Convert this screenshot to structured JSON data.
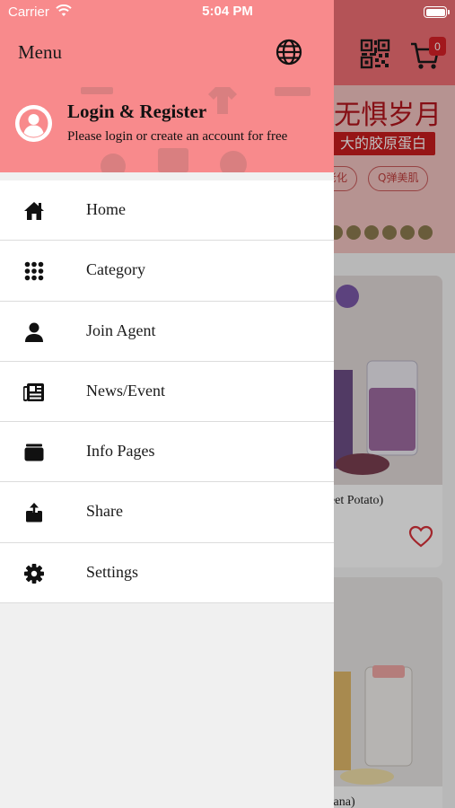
{
  "status_bar": {
    "carrier": "Carrier",
    "time": "5:04 PM"
  },
  "drawer": {
    "title": "Menu",
    "language_icon": "globe-icon",
    "profile": {
      "title": "Login & Register",
      "subtitle": "Please login or create an account for free",
      "avatar_icon": "person-circle-icon"
    },
    "items": [
      {
        "label": "Home",
        "icon": "home-icon"
      },
      {
        "label": "Category",
        "icon": "grid-dots-icon"
      },
      {
        "label": "Join Agent",
        "icon": "person-icon"
      },
      {
        "label": "News/Event",
        "icon": "newspaper-icon"
      },
      {
        "label": "Info Pages",
        "icon": "folder-icon"
      },
      {
        "label": "Share",
        "icon": "share-icon"
      },
      {
        "label": "Settings",
        "icon": "gear-icon"
      }
    ]
  },
  "background": {
    "cart_count": "0",
    "banner": {
      "title": "无惧岁月",
      "subtitle": "大的胶原蛋白",
      "pills": [
        "老化",
        "Q弹美肌"
      ]
    },
    "products": [
      {
        "name": "Sweet Potato)"
      },
      {
        "name": "Banana)"
      }
    ]
  },
  "colors": {
    "drawer_header": "#f88a8c",
    "app_header": "#f06f74",
    "cart_badge": "#d92027",
    "heart": "#d9323a"
  }
}
